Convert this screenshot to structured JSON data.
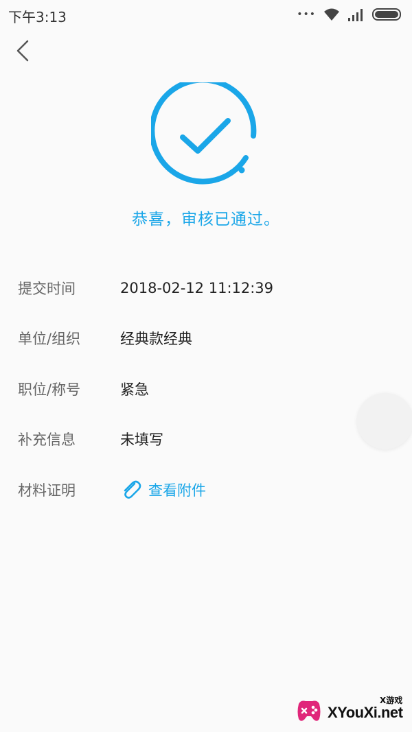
{
  "status_bar": {
    "time": "下午3:13",
    "more_glyph": "•••"
  },
  "header": {
    "back_icon": "chevron-left-icon"
  },
  "result": {
    "icon": "check-circle-icon",
    "message": "恭喜，审核已通过。",
    "accent": "#1aa6e8"
  },
  "info": {
    "rows": [
      {
        "label": "提交时间",
        "value": "2018-02-12 11:12:39"
      },
      {
        "label": "单位/组织",
        "value": "经典款经典"
      },
      {
        "label": "职位/称号",
        "value": "紧急"
      },
      {
        "label": "补充信息",
        "value": "未填写"
      },
      {
        "label": "材料证明",
        "value": "查看附件"
      }
    ]
  },
  "watermark": {
    "site": "XYouXi.net",
    "tag": "X游戏"
  }
}
